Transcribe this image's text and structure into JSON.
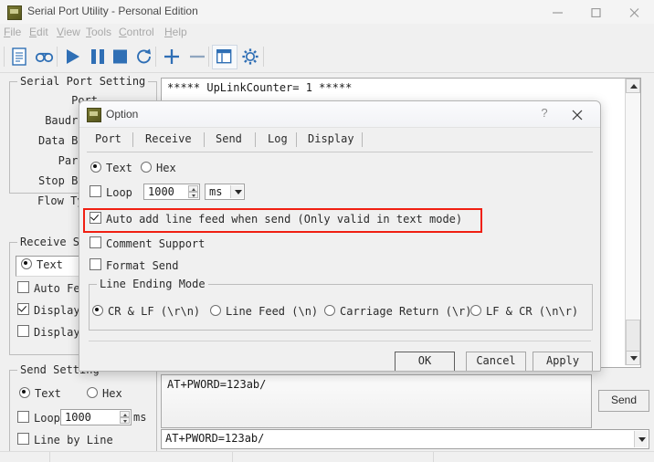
{
  "window": {
    "title": "Serial Port Utility - Personal Edition",
    "icon": "app-icon",
    "controls": {
      "minimize": "minimize-icon",
      "maximize": "maximize-icon",
      "close": "close-icon"
    }
  },
  "menubar": {
    "items": [
      {
        "label": "File",
        "mnemonic": "F"
      },
      {
        "label": "Edit",
        "mnemonic": "E"
      },
      {
        "label": "View",
        "mnemonic": "V"
      },
      {
        "label": "Tools",
        "mnemonic": "T"
      },
      {
        "label": "Control",
        "mnemonic": "C"
      },
      {
        "label": "Help",
        "mnemonic": "H"
      }
    ]
  },
  "toolbar": {
    "buttons": [
      {
        "icon": "new-document-icon"
      },
      {
        "icon": "record-log-icon"
      },
      {
        "icon": "play-icon"
      },
      {
        "icon": "pause-icon"
      },
      {
        "icon": "stop-icon"
      },
      {
        "icon": "refresh-icon"
      },
      {
        "icon": "plus-icon"
      },
      {
        "icon": "minus-icon"
      },
      {
        "icon": "panel-layout-icon"
      },
      {
        "icon": "settings-gear-icon"
      }
    ]
  },
  "sidebar": {
    "serial_port_setting": {
      "legend": "Serial Port Setting",
      "fields": [
        "Port",
        "Baudrate",
        "Data Bits",
        "Parity",
        "Stop Bits",
        "Flow Type"
      ]
    },
    "receive_setting": {
      "legend": "Receive S",
      "mode": {
        "label": "Text",
        "checked": true
      },
      "options": [
        {
          "label": "Auto Fe",
          "checked": false
        },
        {
          "label": "Display",
          "checked": true
        },
        {
          "label": "Display",
          "checked": false
        }
      ]
    },
    "send_setting": {
      "legend": "Send Setting",
      "text_label": "Text",
      "text_checked": true,
      "hex_label": "Hex",
      "hex_checked": false,
      "loop_label": "Loop",
      "loop_checked": false,
      "loop_value": "1000",
      "loop_unit": "ms",
      "line_by_line_label": "Line by Line",
      "line_by_line_checked": false
    }
  },
  "main": {
    "receive_text": "***** UpLinkCounter= 1 *****",
    "send_text": "AT+PWORD=123ab/",
    "history_value": "AT+PWORD=123ab/",
    "send_button": "Send"
  },
  "dialog": {
    "title": "Option",
    "icon": "app-icon",
    "help_glyph": "?",
    "close_icon": "close-icon",
    "tabs": [
      {
        "label": "Port",
        "selected": false
      },
      {
        "label": "Receive",
        "selected": false
      },
      {
        "label": "Send",
        "selected": true
      },
      {
        "label": "Log",
        "selected": false
      },
      {
        "label": "Display",
        "selected": false
      }
    ],
    "send_tab": {
      "format": {
        "text_label": "Text",
        "text_checked": true,
        "hex_label": "Hex",
        "hex_checked": false
      },
      "loop": {
        "label": "Loop",
        "checked": false,
        "value": "1000",
        "unit": "ms"
      },
      "auto_line_feed": {
        "label": "Auto add line feed when send (Only valid in text mode)",
        "checked": true,
        "highlighted": true,
        "highlight_color": "#f01f12"
      },
      "comment_support": {
        "label": "Comment Support",
        "checked": false
      },
      "format_send": {
        "label": "Format Send",
        "checked": false
      },
      "line_ending_mode": {
        "legend": "Line Ending Mode",
        "options": [
          {
            "label": "CR & LF (\\r\\n)",
            "selected": true
          },
          {
            "label": "Line Feed (\\n)",
            "selected": false
          },
          {
            "label": "Carriage Return (\\r)",
            "selected": false
          },
          {
            "label": "LF & CR (\\n\\r)",
            "selected": false
          }
        ]
      }
    },
    "buttons": [
      {
        "label": "OK",
        "focused": true
      },
      {
        "label": "Cancel",
        "focused": false
      },
      {
        "label": "Apply",
        "focused": false
      }
    ]
  }
}
